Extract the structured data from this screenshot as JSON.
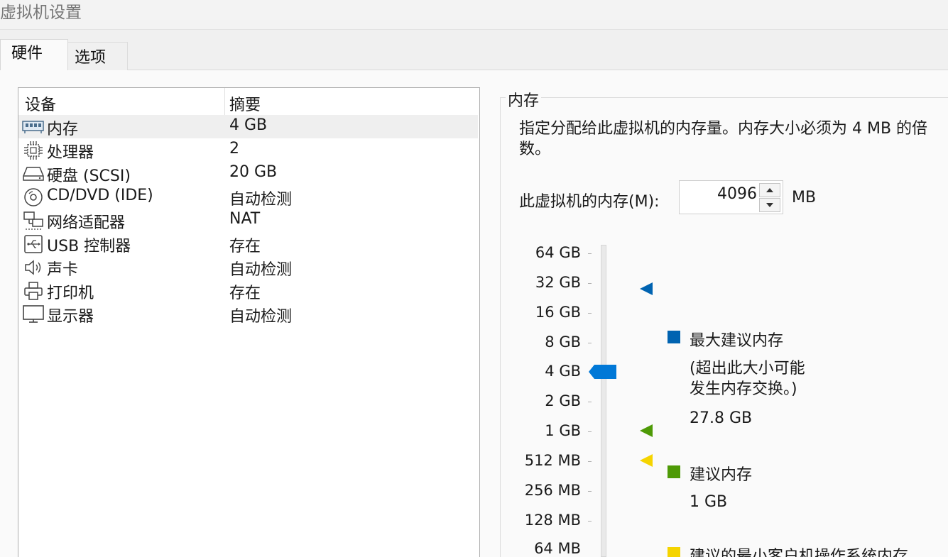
{
  "window": {
    "title": "虚拟机设置"
  },
  "tabs": [
    {
      "label": "硬件",
      "active": true
    },
    {
      "label": "选项",
      "active": false
    }
  ],
  "device_list": {
    "columns": {
      "device": "设备",
      "summary": "摘要"
    },
    "rows": [
      {
        "icon": "memory-icon",
        "name": "内存",
        "summary": "4 GB",
        "selected": true
      },
      {
        "icon": "processor-icon",
        "name": "处理器",
        "summary": "2"
      },
      {
        "icon": "hard-disk-icon",
        "name": "硬盘 (SCSI)",
        "summary": "20 GB"
      },
      {
        "icon": "cd-dvd-icon",
        "name": "CD/DVD (IDE)",
        "summary": "自动检测"
      },
      {
        "icon": "network-adapter-icon",
        "name": "网络适配器",
        "summary": "NAT"
      },
      {
        "icon": "usb-icon",
        "name": "USB 控制器",
        "summary": "存在"
      },
      {
        "icon": "sound-card-icon",
        "name": "声卡",
        "summary": "自动检测"
      },
      {
        "icon": "printer-icon",
        "name": "打印机",
        "summary": "存在"
      },
      {
        "icon": "display-icon",
        "name": "显示器",
        "summary": "自动检测"
      }
    ]
  },
  "memory_panel": {
    "group_title": "内存",
    "description": "指定分配给此虚拟机的内存量。内存大小必须为 4 MB 的倍数。",
    "field_label": "此虚拟机的内存(M):",
    "value": "4096",
    "unit": "MB",
    "scale_labels": [
      "64 GB",
      "32 GB",
      "16 GB",
      "8 GB",
      "4 GB",
      "2 GB",
      "1 GB",
      "512 MB",
      "256 MB",
      "128 MB",
      "64 MB"
    ],
    "slider_current": "4 GB",
    "max_recommended": {
      "title": "最大建议内存",
      "note": "(超出此大小可能\n发生内存交换。)",
      "value": "27.8 GB",
      "color": "#0063b1"
    },
    "recommended": {
      "title": "建议内存",
      "value": "1 GB",
      "color": "#4e9a06"
    },
    "min_recommended": {
      "title": "建议的最小客户机操作系统内存",
      "color": "#f5d400"
    },
    "thumb_color": "#0078d7"
  }
}
